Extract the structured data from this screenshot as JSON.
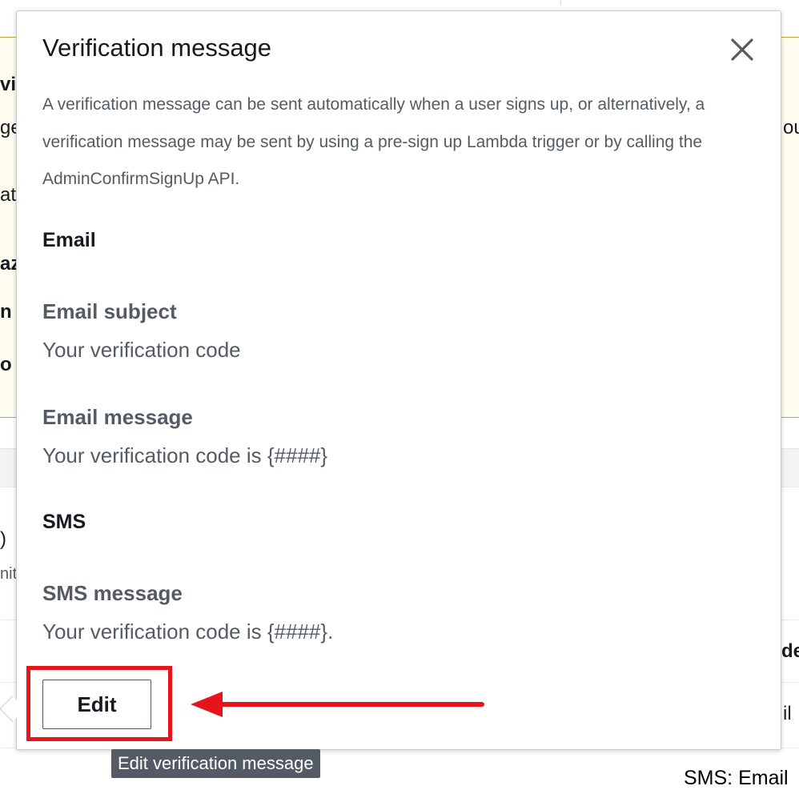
{
  "popover": {
    "title": "Verification message",
    "description": "A verification message can be sent automatically when a user signs up, or alternatively, a verification message may be sent by using a pre-sign up Lambda trigger or by calling the AdminConfirmSignUp API.",
    "email_section": "Email",
    "email_subject_label": "Email subject",
    "email_subject_value": "Your verification code",
    "email_message_label": "Email message",
    "email_message_value": "Your verification code is {####}",
    "sms_section": "SMS",
    "sms_message_label": "SMS message",
    "sms_message_value": "Your verification code is {####}.",
    "edit_label": "Edit",
    "close_icon": "close-icon"
  },
  "tooltip": "Edit verification message",
  "background": {
    "fragments": [
      "vi",
      "ge",
      "at",
      "az",
      "n",
      "o",
      "ou",
      ")",
      "nit",
      "de",
      "il"
    ],
    "footer_text": "SMS: Email"
  },
  "annotation": {
    "highlight_color": "#e8141c",
    "arrow_color": "#e8141c"
  }
}
